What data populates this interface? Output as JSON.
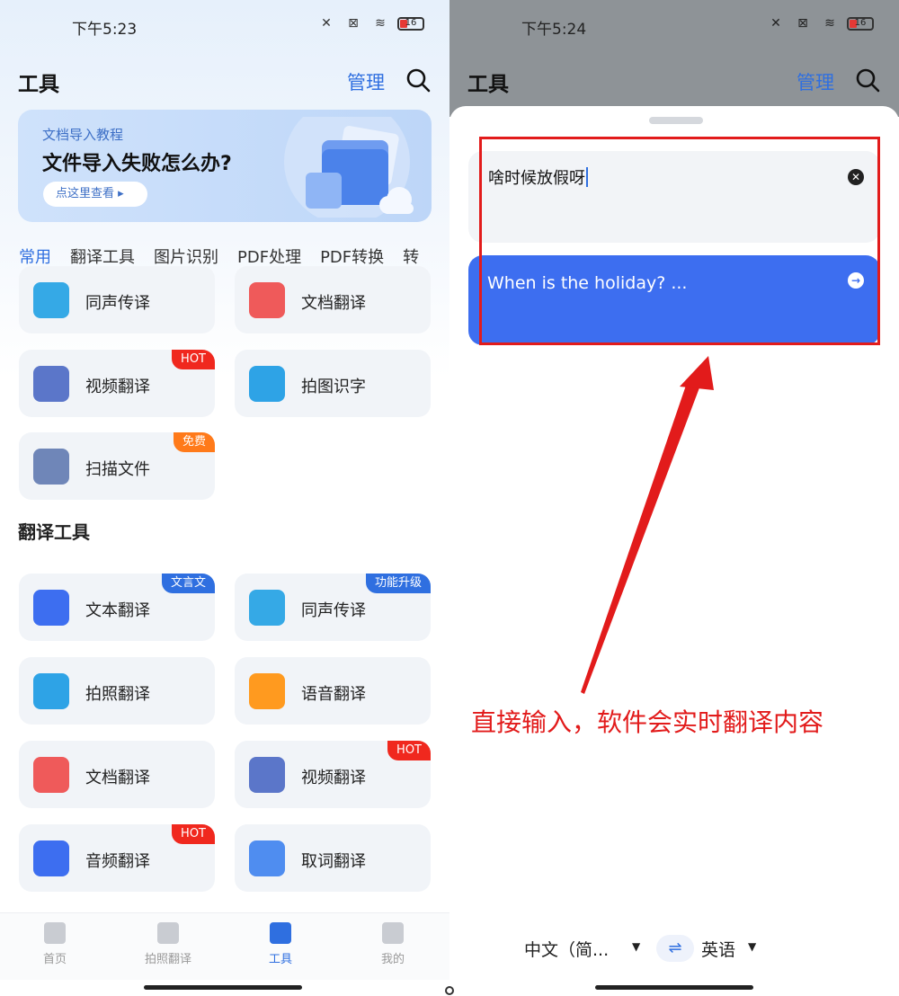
{
  "left": {
    "status": {
      "time": "下午5:23",
      "battery": "16"
    },
    "header": {
      "title": "工具",
      "manage": "管理"
    },
    "banner": {
      "subtitle": "文档导入教程",
      "title": "文件导入失败怎么办?",
      "button": "点这里查看 ▸"
    },
    "tabs": [
      "常用",
      "翻译工具",
      "图片识别",
      "PDF处理",
      "PDF转换",
      "转"
    ],
    "common_cards": [
      {
        "label": "同声传译",
        "icon": "simultaneous-interpretation-icon",
        "color": "#35a9e6"
      },
      {
        "label": "文档翻译",
        "icon": "document-translate-icon",
        "color": "#ef5a5a"
      },
      {
        "label": "视频翻译",
        "icon": "video-translate-icon",
        "color": "#5b76c9",
        "badge": "HOT",
        "badge_color": "#f0281e"
      },
      {
        "label": "拍图识字",
        "icon": "photo-ocr-icon",
        "color": "#2ea3e6"
      },
      {
        "label": "扫描文件",
        "icon": "scan-file-icon",
        "color": "#6f86b8",
        "badge": "免费",
        "badge_color": "#ff7a1a"
      }
    ],
    "section_title": "翻译工具",
    "tool_cards": [
      {
        "label": "文本翻译",
        "icon": "text-translate-icon",
        "color": "#3d6ef0",
        "badge": "文言文",
        "badge_color": "#2f6fe0"
      },
      {
        "label": "同声传译",
        "icon": "simultaneous-interpretation-icon",
        "color": "#35a9e6",
        "badge": "功能升级",
        "badge_color": "#2f6fe0"
      },
      {
        "label": "拍照翻译",
        "icon": "camera-translate-icon",
        "color": "#2ea3e6"
      },
      {
        "label": "语音翻译",
        "icon": "voice-translate-icon",
        "color": "#ff9a1f"
      },
      {
        "label": "文档翻译",
        "icon": "document-translate-icon",
        "color": "#ef5a5a"
      },
      {
        "label": "视频翻译",
        "icon": "video-translate-icon",
        "color": "#5b76c9",
        "badge": "HOT",
        "badge_color": "#f0281e"
      },
      {
        "label": "音频翻译",
        "icon": "audio-translate-icon",
        "color": "#3d6ef0",
        "badge": "HOT",
        "badge_color": "#f0281e"
      },
      {
        "label": "取词翻译",
        "icon": "word-pick-translate-icon",
        "color": "#4f8df0"
      }
    ],
    "tabbar": [
      "首页",
      "拍照翻译",
      "工具",
      "我的"
    ],
    "tabbar_active": 2
  },
  "right": {
    "status": {
      "time": "下午5:24",
      "battery": "16"
    },
    "header": {
      "title": "工具",
      "manage": "管理"
    },
    "input_text": "啥时候放假呀",
    "output_text": "When is the holiday? ...",
    "annotation": "直接输入，软件会实时翻译内容",
    "source_lang": "中文（简...",
    "target_lang": "英语",
    "swap_icon": "⇌",
    "highlight_color": "#e21b1b"
  }
}
